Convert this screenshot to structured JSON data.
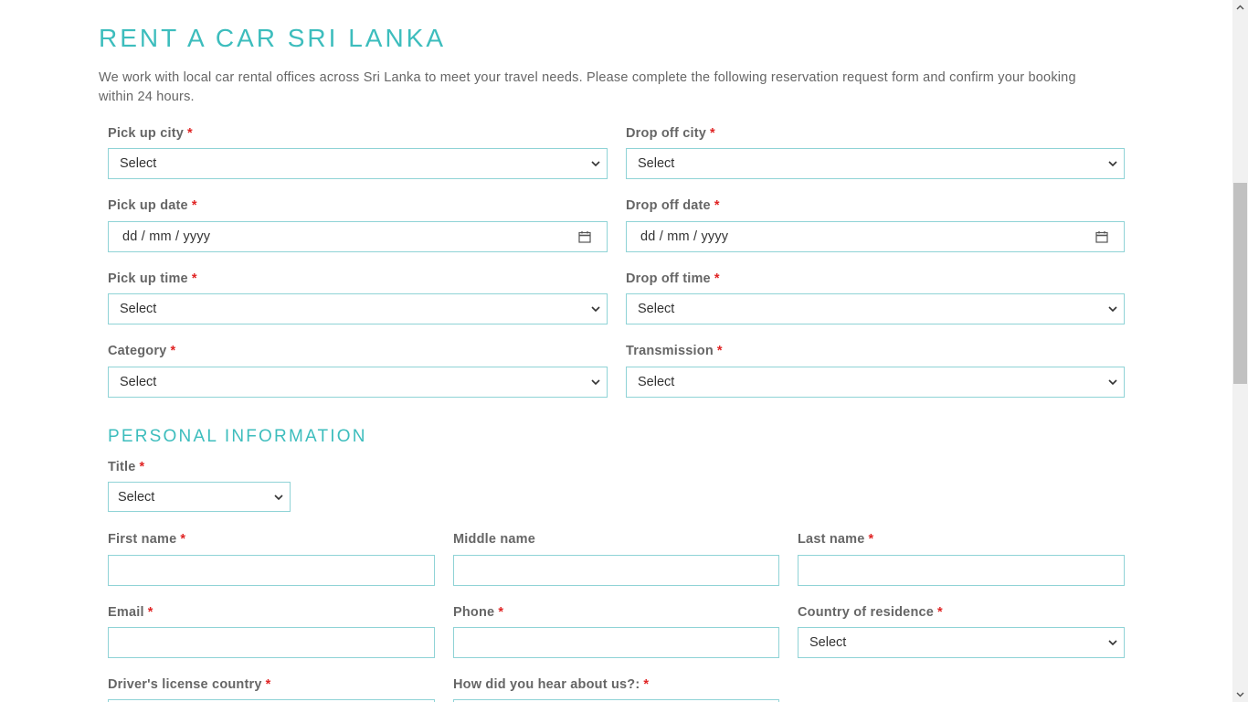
{
  "page": {
    "title": "RENT A CAR SRI LANKA",
    "intro": "We work with local car rental offices across Sri Lanka to meet your travel needs. Please complete the following reservation request form and confirm your booking within 24 hours."
  },
  "required_marker": "*",
  "reservation": {
    "pickup_city": {
      "label": "Pick up city",
      "value": "Select"
    },
    "dropoff_city": {
      "label": "Drop off city",
      "value": "Select"
    },
    "pickup_date": {
      "label": "Pick up date",
      "placeholder": "dd / mm / yyyy"
    },
    "dropoff_date": {
      "label": "Drop off date",
      "placeholder": "dd / mm / yyyy"
    },
    "pickup_time": {
      "label": "Pick up time",
      "value": "Select"
    },
    "dropoff_time": {
      "label": "Drop off time",
      "value": "Select"
    },
    "category": {
      "label": "Category",
      "value": "Select"
    },
    "transmission": {
      "label": "Transmission",
      "value": "Select"
    }
  },
  "personal": {
    "section_title": "PERSONAL INFORMATION",
    "title_field": {
      "label": "Title",
      "value": "Select"
    },
    "first_name": {
      "label": "First name",
      "value": ""
    },
    "middle_name": {
      "label": "Middle name",
      "value": ""
    },
    "last_name": {
      "label": "Last name",
      "value": ""
    },
    "email": {
      "label": "Email",
      "value": ""
    },
    "phone": {
      "label": "Phone",
      "value": ""
    },
    "country": {
      "label": "Country of residence",
      "value": "Select"
    },
    "license_country": {
      "label": "Driver's license country"
    },
    "hear_about": {
      "label": "How did you hear about us?:"
    }
  },
  "colors": {
    "accent": "#3dbdbd",
    "required": "#e02424",
    "field_border": "#8fd3d6"
  },
  "icons": {
    "select_arrow": "chevron-down-icon",
    "date_picker": "calendar-icon"
  }
}
